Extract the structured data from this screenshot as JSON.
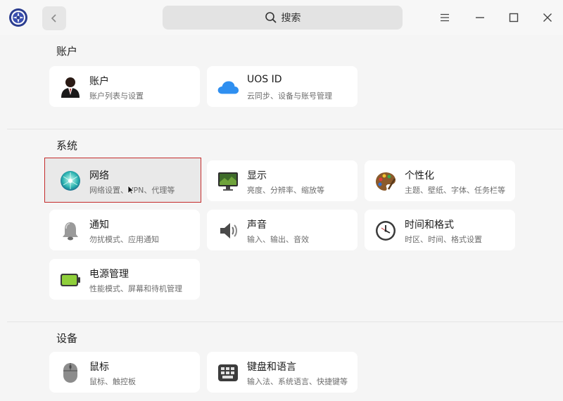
{
  "header": {
    "search_placeholder": "搜索"
  },
  "sections": {
    "accounts": {
      "title": "账户",
      "items": [
        {
          "title": "账户",
          "desc": "账户列表与设置",
          "icon": "user-icon"
        },
        {
          "title": "UOS ID",
          "desc": "云同步、设备与账号管理",
          "icon": "cloud-icon"
        }
      ]
    },
    "system": {
      "title": "系统",
      "items": [
        {
          "title": "网络",
          "desc": "网络设置、VPN、代理等",
          "icon": "network-icon"
        },
        {
          "title": "显示",
          "desc": "亮度、分辨率、缩放等",
          "icon": "display-icon"
        },
        {
          "title": "个性化",
          "desc": "主题、壁纸、字体、任务栏等",
          "icon": "palette-icon"
        },
        {
          "title": "通知",
          "desc": "勿扰模式、应用通知",
          "icon": "bell-icon"
        },
        {
          "title": "声音",
          "desc": "输入、输出、音效",
          "icon": "speaker-icon"
        },
        {
          "title": "时间和格式",
          "desc": "时区、时间、格式设置",
          "icon": "clock-icon"
        },
        {
          "title": "电源管理",
          "desc": "性能模式、屏幕和待机管理",
          "icon": "battery-icon"
        }
      ]
    },
    "devices": {
      "title": "设备",
      "items": [
        {
          "title": "鼠标",
          "desc": "鼠标、触控板",
          "icon": "mouse-icon"
        },
        {
          "title": "键盘和语言",
          "desc": "输入法、系统语言、快捷键等",
          "icon": "keyboard-icon"
        }
      ]
    }
  },
  "colors": {
    "selection_border": "#c42b2b",
    "card_bg": "#ffffff",
    "page_bg": "#f5f5f5"
  }
}
